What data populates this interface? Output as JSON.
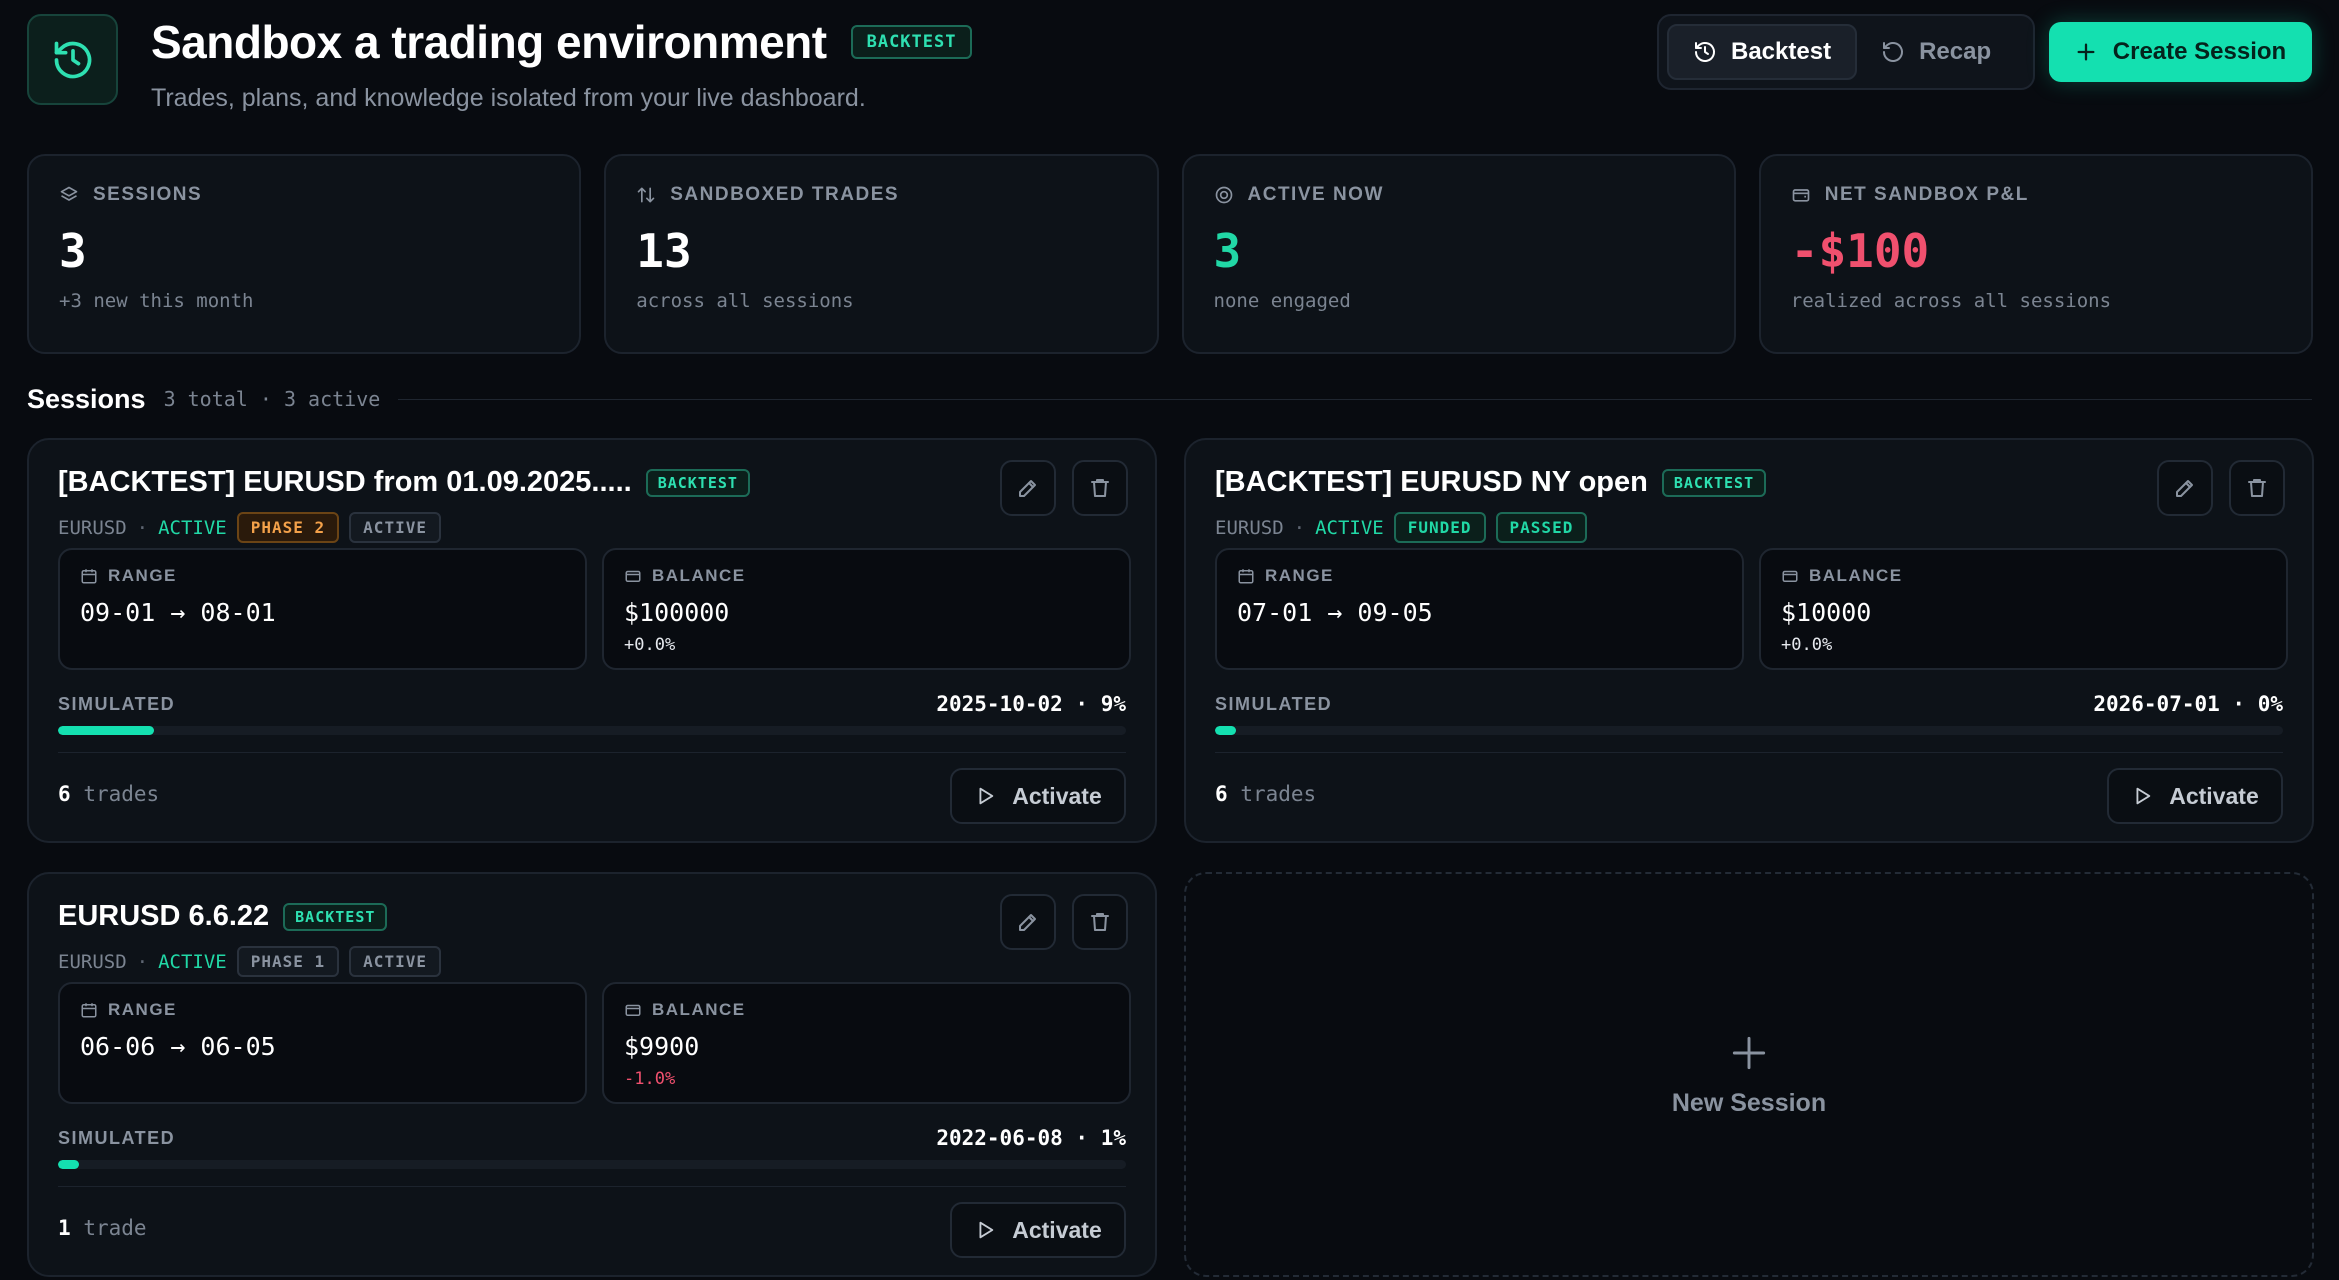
{
  "header": {
    "title": "Sandbox a trading environment",
    "badge": "BACKTEST",
    "subtitle": "Trades, plans, and knowledge isolated from your live dashboard.",
    "modes": [
      {
        "label": "Backtest",
        "icon": "history-icon",
        "active": true
      },
      {
        "label": "Recap",
        "icon": "rotate-ccw-icon",
        "active": false
      }
    ],
    "create_label": "Create Session"
  },
  "stats": [
    {
      "label": "SESSIONS",
      "icon": "layers-icon",
      "value": "3",
      "sub": "+3 new this month",
      "tone": "white"
    },
    {
      "label": "SANDBOXED TRADES",
      "icon": "arrows-updown-icon",
      "value": "13",
      "sub": "across all sessions",
      "tone": "white"
    },
    {
      "label": "ACTIVE NOW",
      "icon": "target-icon",
      "value": "3",
      "sub": "none engaged",
      "tone": "green"
    },
    {
      "label": "NET SANDBOX P&L",
      "icon": "wallet-icon",
      "value": "-$100",
      "sub": "realized across all sessions",
      "tone": "red"
    }
  ],
  "sessions_section": {
    "title": "Sessions",
    "meta": "3 total · 3 active"
  },
  "sessions": [
    {
      "title": "[BACKTEST] EURUSD from 01.09.2025.....",
      "badge": "BACKTEST",
      "pair": "EURUSD",
      "status": "ACTIVE",
      "tags": [
        {
          "text": "PHASE 2",
          "tone": "orange"
        },
        {
          "text": "ACTIVE",
          "tone": "gray"
        }
      ],
      "range_label": "RANGE",
      "range": "09-01 → 08-01",
      "balance_label": "BALANCE",
      "balance": "$100000",
      "balance_change": "+0.0%",
      "balance_negative": false,
      "simulated_label": "SIMULATED",
      "simulated": "2025-10-02 · 9%",
      "progress": 9,
      "trade_count": "6",
      "trade_word": "trades",
      "activate_label": "Activate"
    },
    {
      "title": "[BACKTEST] EURUSD NY open",
      "badge": "BACKTEST",
      "pair": "EURUSD",
      "status": "ACTIVE",
      "tags": [
        {
          "text": "FUNDED",
          "tone": "green"
        },
        {
          "text": "PASSED",
          "tone": "green"
        }
      ],
      "range_label": "RANGE",
      "range": "07-01 → 09-05",
      "balance_label": "BALANCE",
      "balance": "$10000",
      "balance_change": "+0.0%",
      "balance_negative": false,
      "simulated_label": "SIMULATED",
      "simulated": "2026-07-01 · 0%",
      "progress": 2,
      "trade_count": "6",
      "trade_word": "trades",
      "activate_label": "Activate"
    },
    {
      "title": "EURUSD 6.6.22",
      "badge": "BACKTEST",
      "pair": "EURUSD",
      "status": "ACTIVE",
      "tags": [
        {
          "text": "PHASE 1",
          "tone": "gray"
        },
        {
          "text": "ACTIVE",
          "tone": "gray"
        }
      ],
      "range_label": "RANGE",
      "range": "06-06 → 06-05",
      "balance_label": "BALANCE",
      "balance": "$9900",
      "balance_change": "-1.0%",
      "balance_negative": true,
      "simulated_label": "SIMULATED",
      "simulated": "2022-06-08 · 1%",
      "progress": 2,
      "trade_count": "1",
      "trade_word": "trade",
      "activate_label": "Activate"
    }
  ],
  "new_session_label": "New Session",
  "colors": {
    "accent": "#14e0b0",
    "positive": "#21d8a6",
    "negative": "#f0506e",
    "warning": "#f3a14a",
    "background": "#080b10"
  }
}
